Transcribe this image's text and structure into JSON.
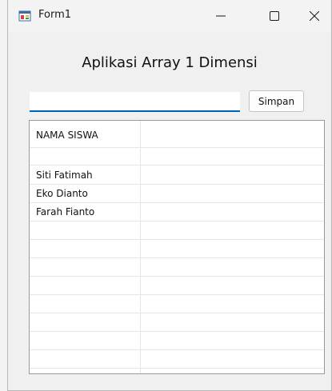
{
  "window": {
    "title": "Form1",
    "icon": "form-app-icon",
    "controls": [
      "minimize-icon",
      "maximize-icon",
      "close-icon"
    ]
  },
  "main": {
    "heading": "Aplikasi Array 1 Dimensi",
    "input": {
      "value": "",
      "placeholder": ""
    },
    "save_label": "Simpan"
  },
  "list": {
    "header": "NAMA SISWA",
    "items": [
      "Siti Fatimah",
      "Eko Dianto",
      "Farah Fianto"
    ]
  },
  "colors": {
    "accent": "#0063b1",
    "window_bg": "#f0f0f0",
    "list_bg": "#ffffff"
  }
}
